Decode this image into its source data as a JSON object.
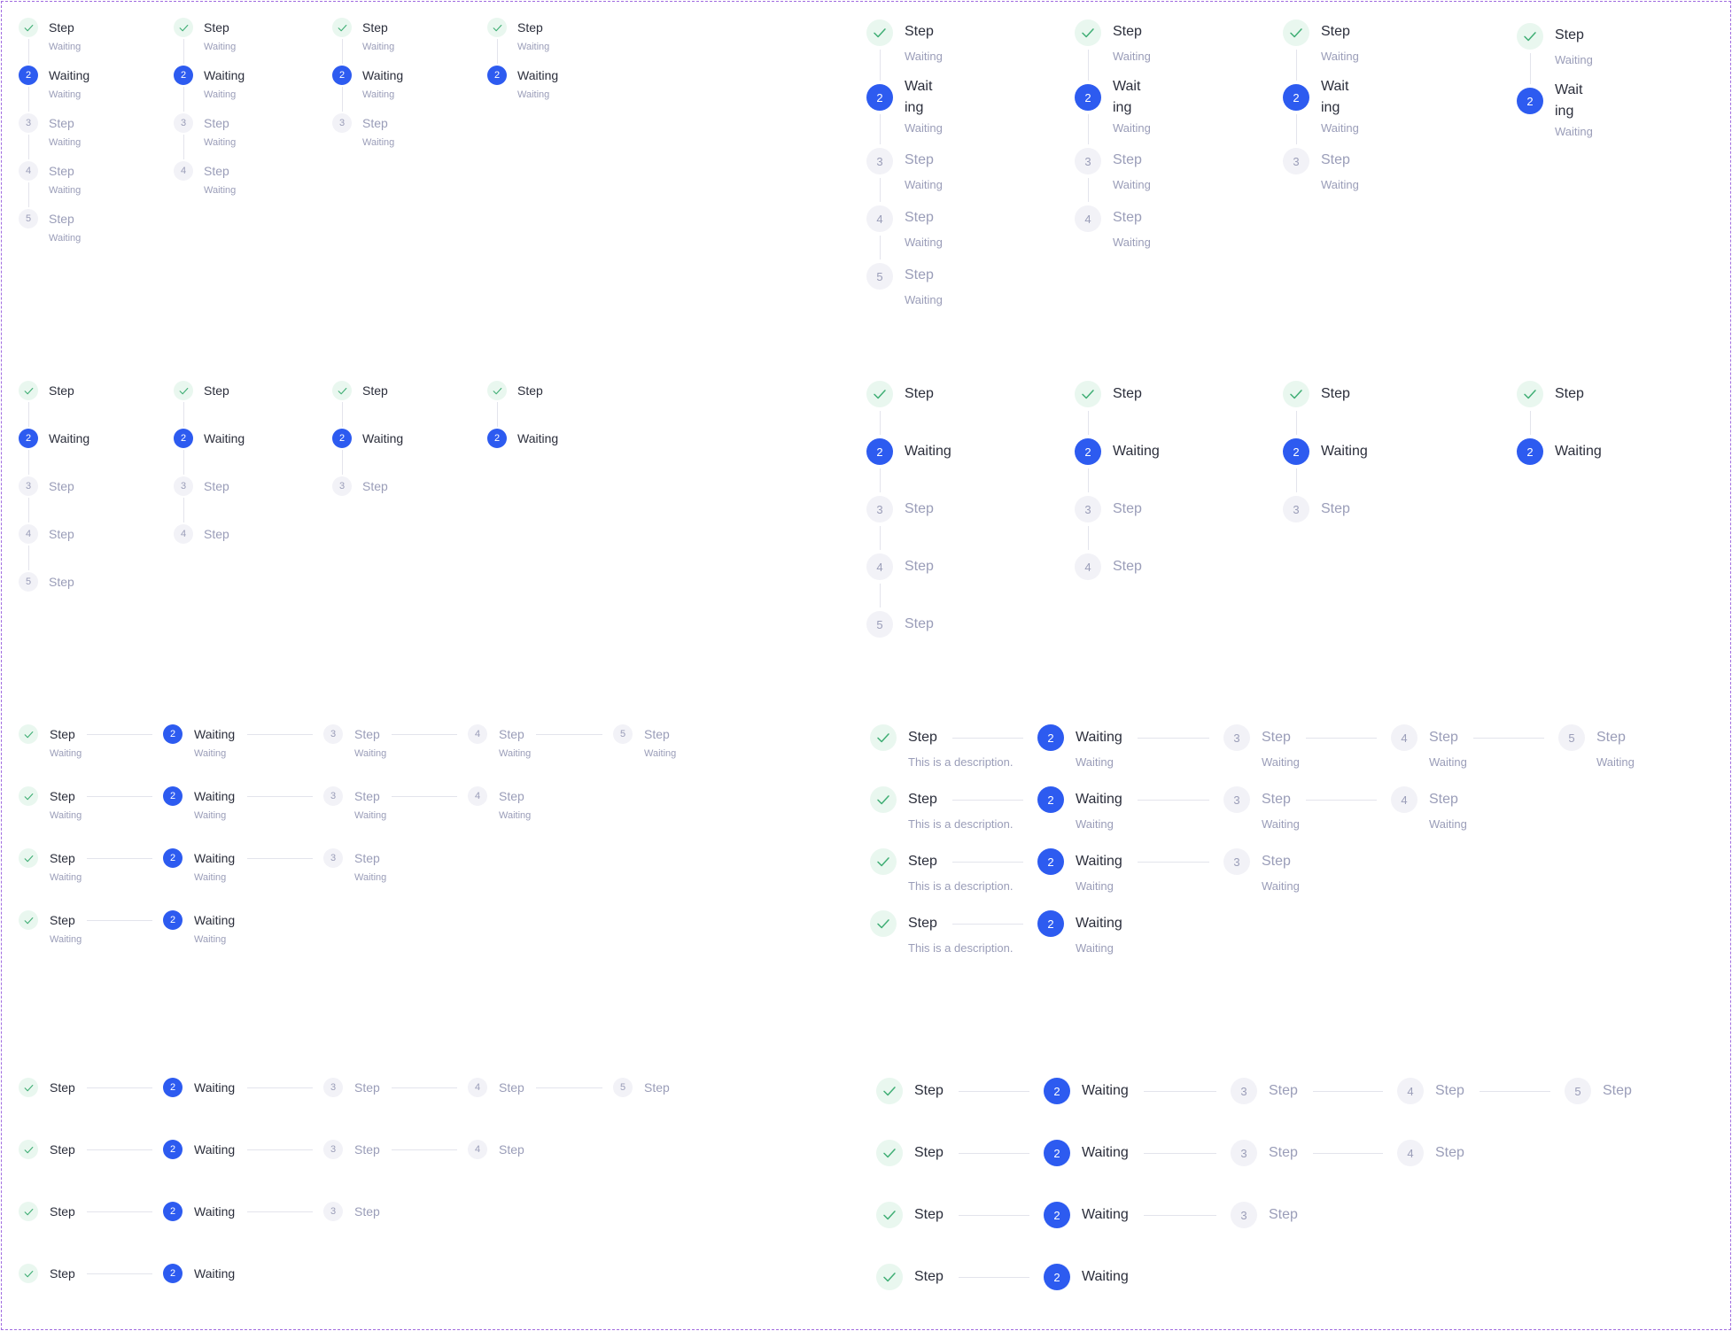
{
  "labels": {
    "step": "Step",
    "waiting": "Waiting",
    "wait_part1": "Wait",
    "wait_part2": "ing",
    "description": "This is a description."
  },
  "step_numbers": [
    "1",
    "2",
    "3",
    "4",
    "5"
  ],
  "icons": {
    "done": "check-icon"
  },
  "colors": {
    "active": "#2d5bf0",
    "done_bg": "#e9f7ef",
    "done_check": "#3fae74",
    "pending_bg": "#f2f2f7",
    "muted_text": "#9a9db8",
    "title_text": "#2b2e3b",
    "connector": "#e3e4ec",
    "frame_border": "#a06be0"
  },
  "groups": [
    {
      "id": "vertical-small-with-subtitle",
      "orientation": "vertical",
      "size": "small",
      "subtitle": true,
      "current_step": 2,
      "step_counts": [
        5,
        4,
        3,
        2
      ]
    },
    {
      "id": "vertical-large-with-subtitle",
      "orientation": "vertical",
      "size": "large",
      "subtitle": true,
      "current_step": 2,
      "step_counts": [
        5,
        4,
        3,
        2
      ]
    },
    {
      "id": "vertical-small-plain",
      "orientation": "vertical",
      "size": "small",
      "subtitle": false,
      "current_step": 2,
      "step_counts": [
        5,
        4,
        3,
        2
      ]
    },
    {
      "id": "vertical-large-plain",
      "orientation": "vertical",
      "size": "large",
      "subtitle": false,
      "current_step": 2,
      "step_counts": [
        5,
        4,
        3,
        2
      ]
    },
    {
      "id": "horizontal-small-with-subtitle",
      "orientation": "horizontal",
      "size": "small",
      "subtitle": true,
      "current_step": 2,
      "step_counts": [
        5,
        4,
        3,
        2
      ]
    },
    {
      "id": "horizontal-large-with-description",
      "orientation": "horizontal",
      "size": "large",
      "subtitle": true,
      "first_step_shows_description": true,
      "current_step": 2,
      "step_counts": [
        5,
        4,
        3,
        2
      ]
    },
    {
      "id": "horizontal-small-plain",
      "orientation": "horizontal",
      "size": "small",
      "subtitle": false,
      "current_step": 2,
      "step_counts": [
        5,
        4,
        3,
        2
      ]
    },
    {
      "id": "horizontal-large-plain",
      "orientation": "horizontal",
      "size": "large",
      "subtitle": false,
      "current_step": 2,
      "step_counts": [
        5,
        4,
        3,
        2
      ]
    }
  ]
}
